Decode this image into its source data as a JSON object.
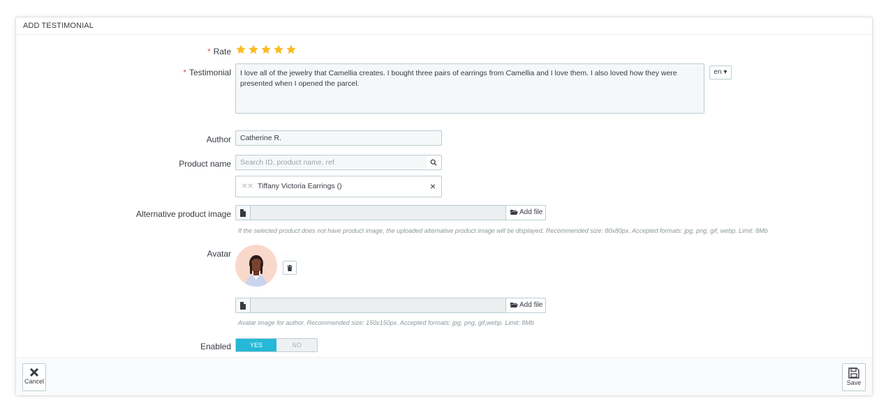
{
  "panel": {
    "title": "ADD TESTIMONIAL"
  },
  "form": {
    "rate": {
      "label": "Rate",
      "required_mark": "*",
      "stars": 5,
      "value": 5
    },
    "testimonial": {
      "label": "Testimonial",
      "required_mark": "*",
      "value": "I love all of the jewelry that Camellia creates. I bought three pairs of earrings from Camellia and I love them. I also loved how they were presented when I opened the parcel.",
      "language": "en ▾"
    },
    "author": {
      "label": "Author",
      "value": "Catherine R."
    },
    "product_name": {
      "label": "Product name",
      "placeholder": "Search ID, product name, ref",
      "selected": "Tiffany Victoria Earrings ()"
    },
    "alt_image": {
      "label": "Alternative product image",
      "button": "Add file",
      "help": "If the selected product does not have product image, the uploaded alternative product image will be displayed. Recommended size: 80x80px. Accepted formats: jpg, png, gif, webp. Limit: 8Mb"
    },
    "avatar": {
      "label": "Avatar",
      "button": "Add file",
      "help": "Avatar image for author. Recommended size: 150x150px. Accepted formats: jpg, png, gif,webp. Limit: 8Mb"
    },
    "enabled": {
      "label": "Enabled",
      "yes": "YES",
      "no": "NO",
      "value": "YES"
    }
  },
  "footer": {
    "cancel": "Cancel",
    "save": "Save"
  },
  "colors": {
    "accent": "#25b9d7",
    "star": "#fbbb22",
    "required": "#e84e4e"
  }
}
